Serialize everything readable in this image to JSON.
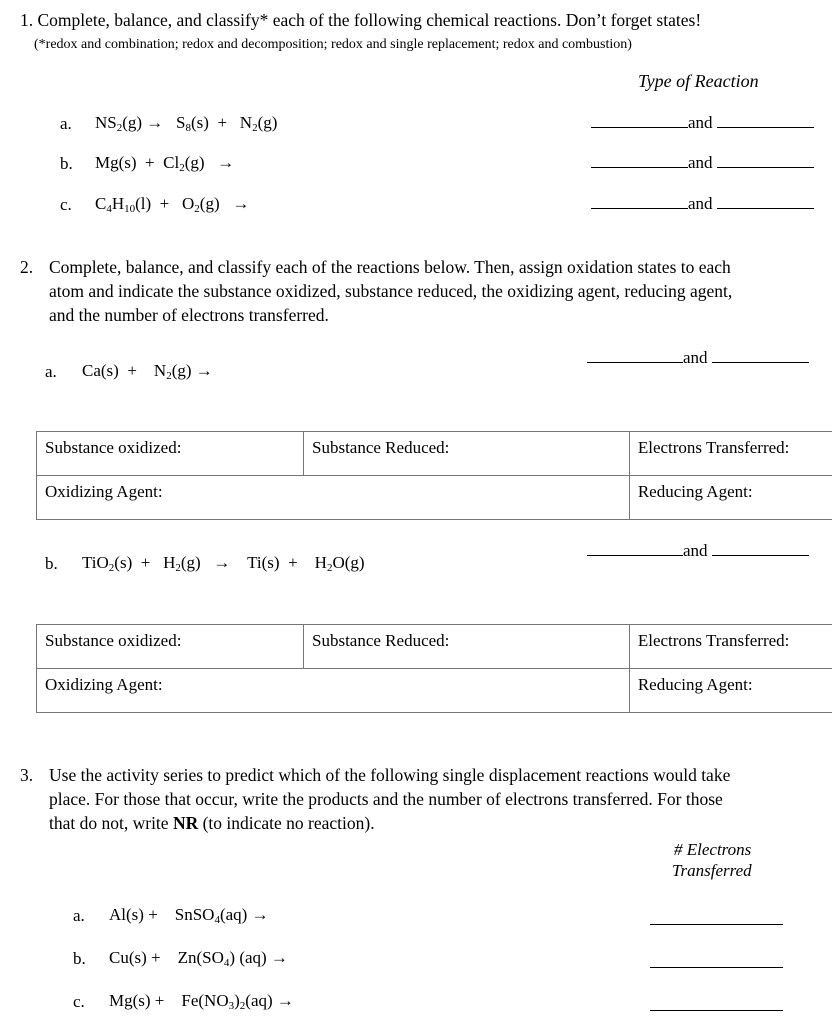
{
  "q1": {
    "number": "1.",
    "title": "Complete, balance, and classify* each of the following chemical reactions.  Don’t forget states!",
    "note": "(*redox and combination; redox and decomposition; redox and single replacement; redox and combustion)",
    "type_header": "Type of Reaction",
    "reactions": [
      {
        "label": "a.",
        "parts": [
          "NS",
          "2",
          "(g) →   S",
          "8",
          "(s)  +   N",
          "2",
          "(g)"
        ]
      },
      {
        "label": "b.",
        "parts": [
          "Mg(s)  +  Cl",
          "2",
          "(g)   →"
        ]
      },
      {
        "label": "c.",
        "parts": [
          "C",
          "4",
          "H",
          "10",
          "(l)  +   O",
          "2",
          "(g)   →"
        ]
      }
    ],
    "and_word": "and"
  },
  "q2": {
    "number": "2.",
    "title_lines": [
      "Complete, balance, and classify each of the reactions below. Then, assign oxidation states to each",
      "atom and indicate the substance oxidized, substance reduced, the oxidizing agent, reducing agent,",
      "and the number of electrons transferred."
    ],
    "and_word": "and",
    "parts": [
      {
        "label": "a.",
        "equation": [
          "Ca(s)  +    N",
          "2",
          "(g) →"
        ]
      },
      {
        "label": "b.",
        "equation": [
          "TiO",
          "2",
          "(s)  +   H",
          "2",
          "(g)   →    Ti(s)  +    H",
          "2",
          "O(g)"
        ]
      }
    ],
    "table": {
      "substance_oxidized": "Substance oxidized:",
      "substance_reduced": "Substance Reduced:",
      "electrons_transferred": "Electrons Transferred:",
      "oxidizing_agent": "Oxidizing Agent:",
      "reducing_agent": "Reducing Agent:"
    }
  },
  "q3": {
    "number": "3.",
    "title_lines": [
      "Use the activity series to predict which of the following single displacement reactions would take",
      "place. For those that occur, write the products and the number of electrons transferred. For those",
      "that do not, write "
    ],
    "nr_bold": "NR",
    "nr_suffix": " (to indicate no reaction).",
    "electrons_header_line1": "# Electrons",
    "electrons_header_line2": "Transferred",
    "reactions": [
      {
        "label": "a.",
        "parts": [
          "Al(s) +    SnSO",
          "4",
          "(aq) →"
        ]
      },
      {
        "label": "b.",
        "parts": [
          "Cu(s) +    Zn(SO",
          "4",
          ") (aq) →"
        ]
      },
      {
        "label": "c.",
        "parts": [
          "Mg(s) +    Fe(NO",
          "3",
          ")",
          "2",
          "(aq) →"
        ]
      }
    ]
  }
}
